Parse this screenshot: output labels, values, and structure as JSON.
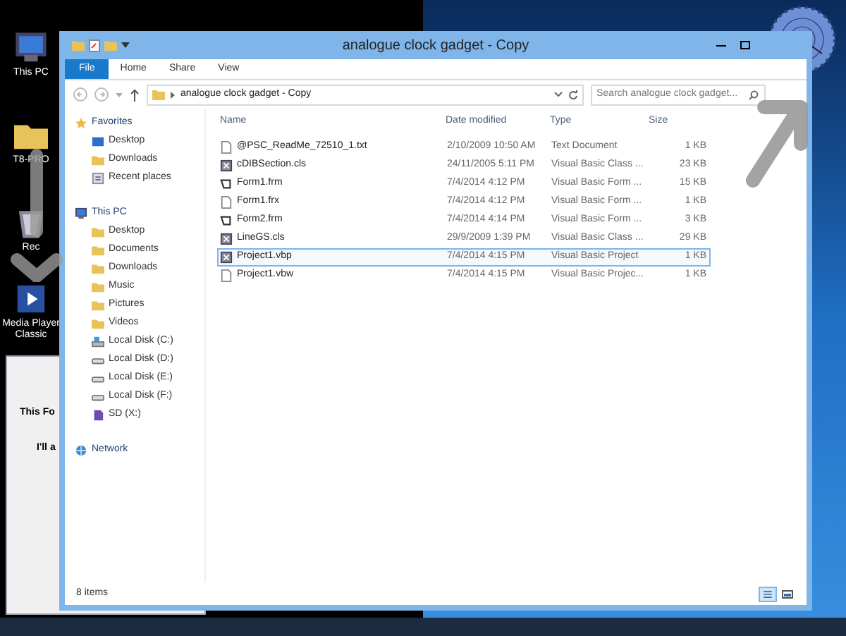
{
  "desktop_icons": [
    {
      "label": "This PC",
      "kind": "pc"
    },
    {
      "label": "T8-PRO",
      "kind": "folder"
    },
    {
      "label": "Rec",
      "kind": "bin"
    },
    {
      "label": "Media Player Classic",
      "kind": "app"
    }
  ],
  "background_dialog": {
    "texts": [
      "This Fo",
      "I'll a"
    ]
  },
  "window": {
    "title": "analogue clock gadget - Copy"
  },
  "ribbon_tabs": [
    {
      "label": "File",
      "selected": true
    },
    {
      "label": "Home",
      "selected": false
    },
    {
      "label": "Share",
      "selected": false
    },
    {
      "label": "View",
      "selected": false
    }
  ],
  "address_bar": {
    "path": "analogue clock gadget - Copy"
  },
  "search": {
    "placeholder": "Search analogue clock gadget..."
  },
  "nav_pane": [
    {
      "label": "Favorites",
      "kind": "star",
      "children": [
        {
          "label": "Desktop",
          "kind": "desktop"
        },
        {
          "label": "Downloads",
          "kind": "folder"
        },
        {
          "label": "Recent places",
          "kind": "recent"
        }
      ]
    },
    {
      "label": "This PC",
      "kind": "pc",
      "children": [
        {
          "label": "Desktop",
          "kind": "folder"
        },
        {
          "label": "Documents",
          "kind": "folder"
        },
        {
          "label": "Downloads",
          "kind": "folder"
        },
        {
          "label": "Music",
          "kind": "folder"
        },
        {
          "label": "Pictures",
          "kind": "folder"
        },
        {
          "label": "Videos",
          "kind": "folder"
        },
        {
          "label": "Local Disk (C:)",
          "kind": "sysdisk"
        },
        {
          "label": "Local Disk (D:)",
          "kind": "disk"
        },
        {
          "label": "Local Disk (E:)",
          "kind": "disk"
        },
        {
          "label": "Local Disk (F:)",
          "kind": "disk"
        },
        {
          "label": "SD (X:)",
          "kind": "sd"
        }
      ]
    },
    {
      "label": "Network",
      "kind": "network"
    }
  ],
  "table": {
    "columns": [
      "Name",
      "Date modified",
      "Type",
      "Size"
    ],
    "rows": [
      {
        "name": "@PSC_ReadMe_72510_1.txt",
        "date": "2/10/2009 10:50 AM",
        "type": "Text Document",
        "size": "1 KB",
        "kind": "text",
        "selected": false
      },
      {
        "name": "cDIBSection.cls",
        "date": "24/11/2005 5:11 PM",
        "type": "Visual Basic Class ...",
        "size": "23 KB",
        "kind": "vb",
        "selected": false
      },
      {
        "name": "Form1.frm",
        "date": "7/4/2014 4:12 PM",
        "type": "Visual Basic Form ...",
        "size": "15 KB",
        "kind": "form",
        "selected": false
      },
      {
        "name": "Form1.frx",
        "date": "7/4/2014 4:12 PM",
        "type": "Visual Basic Form ...",
        "size": "1 KB",
        "kind": "text",
        "selected": false
      },
      {
        "name": "Form2.frm",
        "date": "7/4/2014 4:14 PM",
        "type": "Visual Basic Form ...",
        "size": "3 KB",
        "kind": "form",
        "selected": false
      },
      {
        "name": "LineGS.cls",
        "date": "29/9/2009 1:39 PM",
        "type": "Visual Basic Class ...",
        "size": "29 KB",
        "kind": "vb",
        "selected": false
      },
      {
        "name": "Project1.vbp",
        "date": "7/4/2014 4:15 PM",
        "type": "Visual Basic Project",
        "size": "1 KB",
        "kind": "vb",
        "selected": true
      },
      {
        "name": "Project1.vbw",
        "date": "7/4/2014 4:15 PM",
        "type": "Visual Basic Projec...",
        "size": "1 KB",
        "kind": "text",
        "selected": false
      }
    ]
  },
  "status_bar": {
    "count": "8 items"
  }
}
